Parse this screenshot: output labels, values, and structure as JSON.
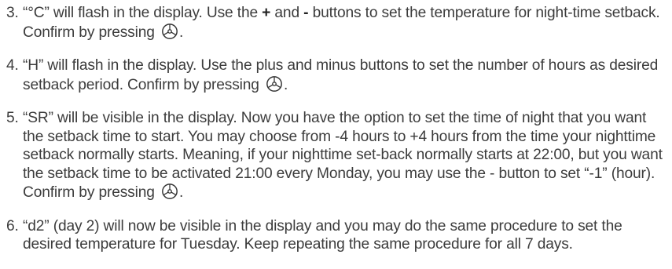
{
  "steps": [
    {
      "number": "3.",
      "text_a": "“°C” will flash in the display. Use the ",
      "plus": "+",
      "text_b": " and ",
      "minus": "-",
      "text_c": " buttons to set the temperature for night-time setback. Confirm by pressing",
      "text_end": ".",
      "icon": "confirm-dial-icon"
    },
    {
      "number": "4.",
      "text": "“H” will flash in the display. Use the plus and minus buttons to set the number of hours as desired setback period. Confirm by pressing",
      "text_end": ".",
      "icon": "confirm-dial-icon"
    },
    {
      "number": "5.",
      "text": "“SR” will be visible in the display. Now you have the option to set the time of night that you want the setback time to start. You may choose from -4 hours to +4 hours from the time your nighttime setback normally starts. Meaning, if your nighttime set-back normally starts at 22:00, but you want the setback time to be activated 21:00 every Monday, you may use the - button to set “-1” (hour). Confirm by pressing",
      "text_end": ".",
      "icon": "confirm-dial-icon"
    },
    {
      "number": "6.",
      "text": "“d2” (day 2) will now be visible in the display and you may do the same procedure to set the desired temperature for Tuesday. Keep repeating the same procedure for all 7 days."
    }
  ],
  "colors": {
    "text": "#3c3c3c",
    "icon": "#333333"
  }
}
